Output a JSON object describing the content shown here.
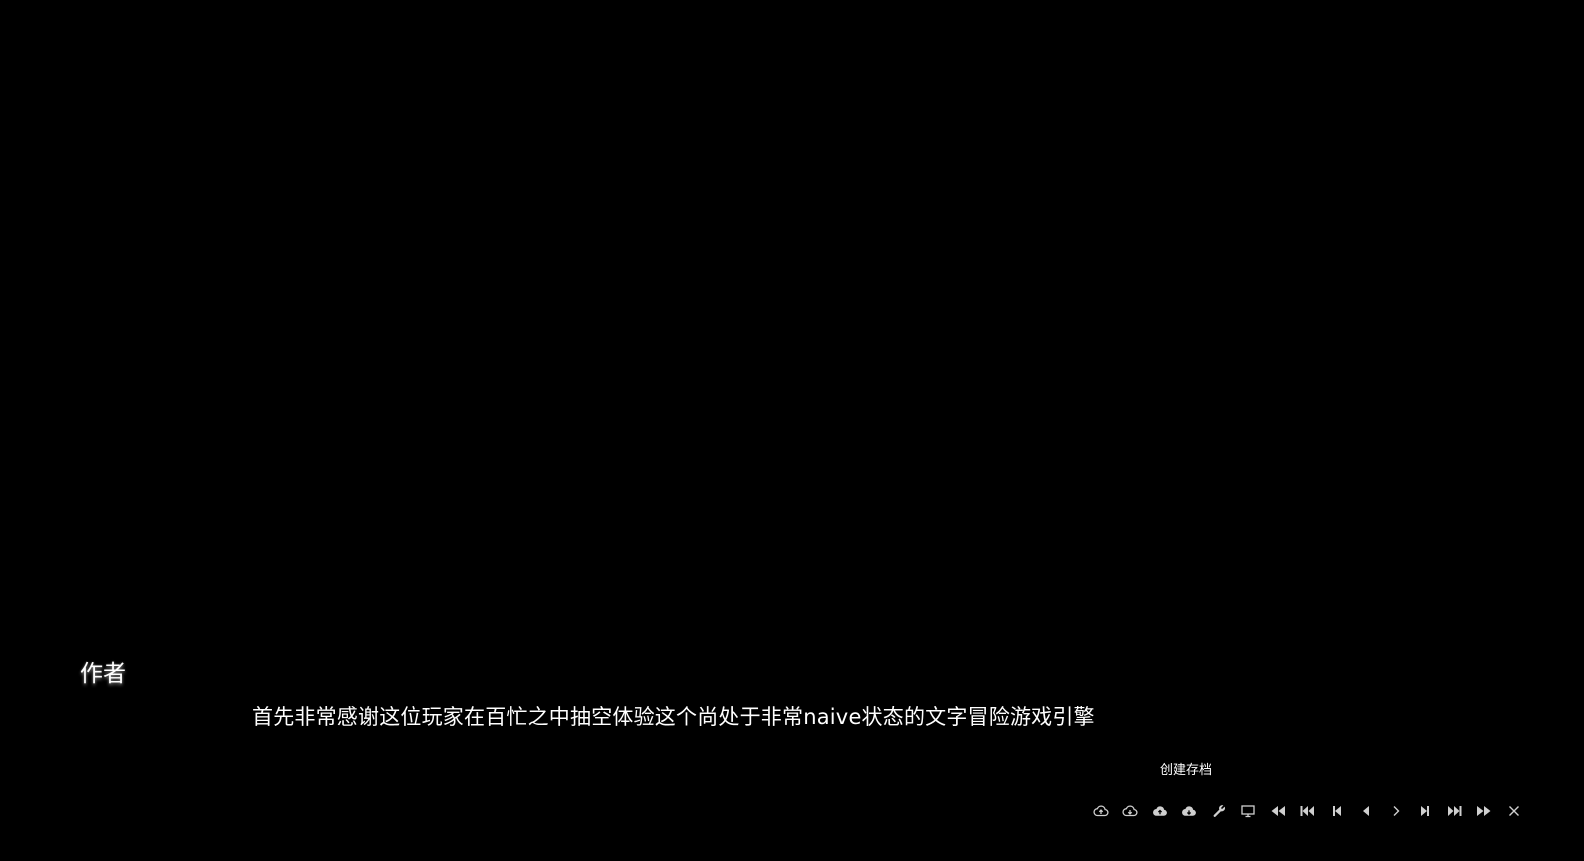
{
  "speaker": {
    "name": "作者"
  },
  "dialogue": {
    "text": "首先非常感谢这位玩家在百忙之中抽空体验这个尚处于非常naive状态的文字冒险游戏引擎"
  },
  "tooltip": {
    "text": "创建存档"
  },
  "toolbar": {
    "icons": [
      "cloud-upload-icon",
      "cloud-download-icon",
      "cloud-save-icon",
      "cloud-load-icon",
      "wrench-icon",
      "monitor-icon",
      "rewind-icon",
      "skip-back-icon",
      "step-back-icon",
      "back-icon",
      "forward-icon",
      "step-forward-icon",
      "skip-forward-icon",
      "fast-forward-icon",
      "close-icon"
    ]
  },
  "colors": {
    "background": "#000000",
    "text": "#ffffff",
    "icon": "#cfcfcf"
  }
}
